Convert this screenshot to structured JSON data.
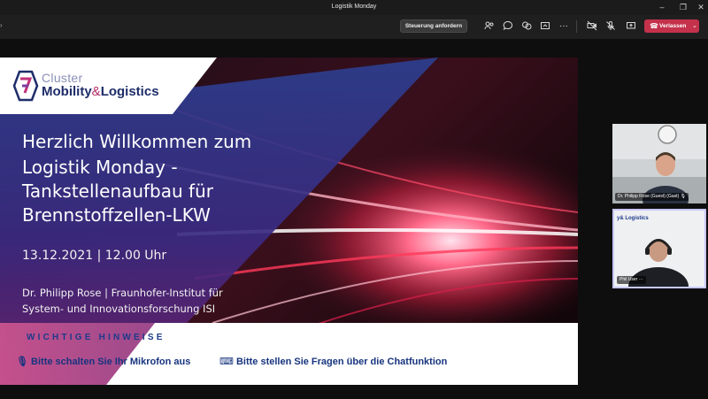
{
  "window": {
    "title": "Logistik Monday"
  },
  "toolbar": {
    "request_control_label": "Steuerung anfordern",
    "leave_label": "Verlassen",
    "icons": [
      "participants-icon",
      "chat-icon",
      "reactions-icon",
      "share-tray-icon",
      "more-icon",
      "camera-icon",
      "mic-off-icon",
      "share-icon"
    ]
  },
  "slide": {
    "logo_cluster": "Cluster",
    "logo_mobility": "Mobility",
    "logo_amp": "&",
    "logo_logistics": "Logistics",
    "title_line1": "Herzlich Willkommen zum",
    "title_line2": "Logistik Monday -",
    "title_line3": "Tankstellenaufbau für",
    "title_line4": "Brennstoffzellen-LKW",
    "date": "13.12.2021 | 12.00 Uhr",
    "speaker_line1": "Dr. Philipp Rose | Fraunhofer-Institut für",
    "speaker_line2": "System- und Innovationsforschung ISI",
    "notes_heading": "WICHTIGE HINWEISE",
    "note_mic": "Bitte schalten Sie Ihr Mikrofon aus",
    "note_chat": "Bitte stellen Sie Fragen über die Chatfunktion"
  },
  "participants": [
    {
      "name": "Dr. Philipp Rose (Guest) (Gast)"
    },
    {
      "name": "Phil User",
      "tile_logo": "y& Logistics"
    }
  ],
  "colors": {
    "leave": "#c4314b",
    "brand_navy": "#1e2d6a",
    "brand_magenta": "#b12a65"
  }
}
